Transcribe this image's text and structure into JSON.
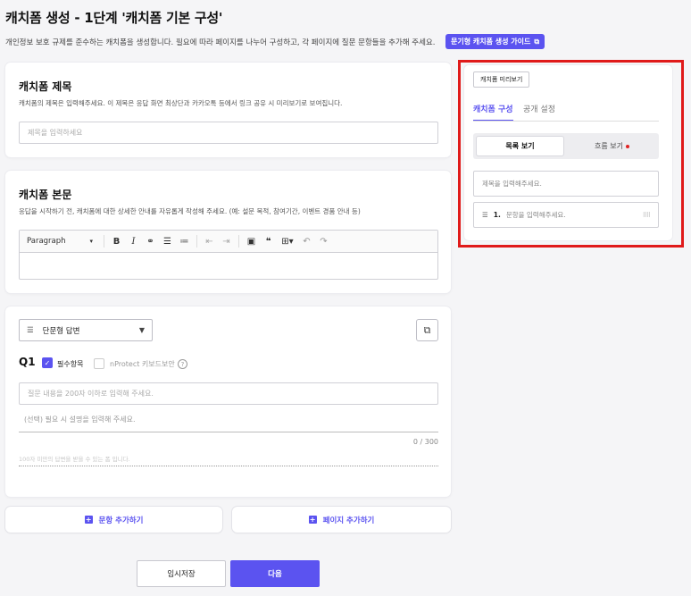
{
  "header": {
    "title": "캐치폼 생성 - 1단계 '캐치폼 기본 구성'",
    "description": "개인정보 보호 규제를 준수하는 캐치폼을 생성합니다. 필요에 따라 페이지를 나누어 구성하고, 각 페이지에 질문 문항들을 추가해 주세요.",
    "guide_button": "문기형 캐치폼 생성 가이드"
  },
  "title_card": {
    "heading": "캐치폼 제목",
    "subtext": "캐치폼의 제목은 입력해주세요. 이 제목은 응답 화면 최상단과 카카오톡 등에서 링크 공유 시 미리보기로 보여집니다.",
    "input_placeholder": "제목을 입력하세요"
  },
  "body_card": {
    "heading": "캐치폼 본문",
    "subtext": "응답을 시작하기 전, 캐치폼에 대한 상세한 안내를 자유롭게 작성해 주세요. (예: 설문 목적, 참여기간, 이벤트 경품 안내 등)",
    "editor_format": "Paragraph"
  },
  "question_card": {
    "type_select": "단문형 답변",
    "q_label": "Q1",
    "required_label": "필수항목",
    "required_checked": true,
    "nprotect_label": "nProtect 키보드보안",
    "nprotect_checked": false,
    "question_placeholder": "질문 내용을 200자 이하로 입력해 주세요.",
    "description_placeholder": "(선택) 필요 시 설명을 입력해 주세요.",
    "char_count": "0 / 300",
    "answer_hint": "100자 미만의 답변을 받을 수 있는 폼 입니다."
  },
  "actions": {
    "add_question": "문항 추가하기",
    "add_page": "페이지 추가하기",
    "temp_save": "임시저장",
    "next": "다음"
  },
  "preview": {
    "preview_button": "캐치폼 미리보기",
    "tabs": [
      "캐치폼 구성",
      "공개 설정"
    ],
    "active_tab": "캐치폼 구성",
    "view_modes": [
      "목록 보기",
      "흐름 보기"
    ],
    "active_view_mode": "목록 보기",
    "title_placeholder": "제목을 입력해주세요.",
    "question_number": "1.",
    "question_placeholder": "문항을 입력해주세요."
  },
  "colors": {
    "accent": "#5b53f0",
    "highlight_border": "#e01a1a",
    "notification_dot": "#e02424"
  }
}
